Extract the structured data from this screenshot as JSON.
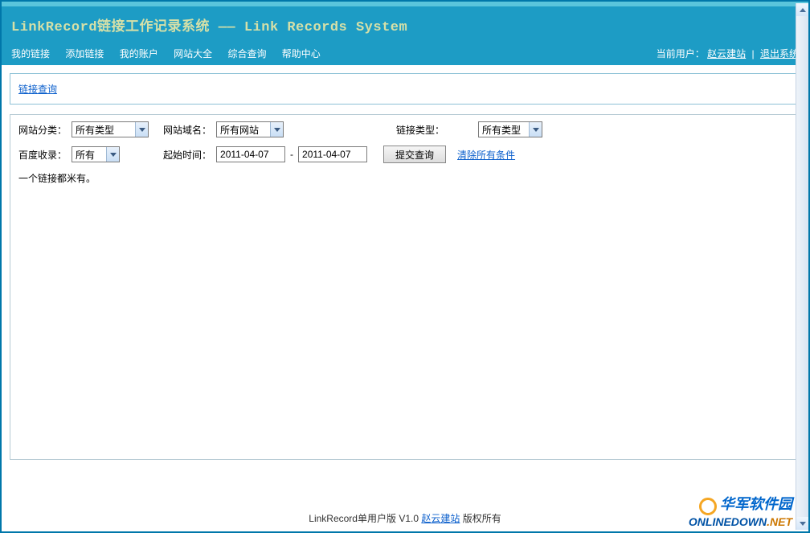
{
  "header": {
    "title_left": "LinkRecord链接工作记录系统",
    "title_sep": "——",
    "title_right": "Link Records System"
  },
  "nav": {
    "items": [
      "我的链接",
      "添加链接",
      "我的账户",
      "网站大全",
      "综合查询",
      "帮助中心"
    ],
    "current_user_label": "当前用户：",
    "current_user": "赵云建站",
    "logout": "退出系统"
  },
  "breadcrumb": {
    "label": "链接查询"
  },
  "form": {
    "row1": {
      "site_category_label": "网站分类：",
      "site_category_value": "所有类型",
      "site_domain_label": "网站域名：",
      "site_domain_value": "所有网站",
      "link_type_label": "链接类型：",
      "link_type_value": "所有类型"
    },
    "row2": {
      "baidu_index_label": "百度收录：",
      "baidu_index_value": "所有",
      "start_time_label": "起始时间：",
      "date_from": "2011-04-07",
      "dash": "-",
      "date_to": "2011-04-07",
      "submit_label": "提交查询",
      "clear_label": "清除所有条件"
    },
    "empty_msg": "一个链接都米有。"
  },
  "footer": {
    "left": "LinkRecord单用户版 V1.0",
    "link": "赵云建站",
    "right": "版权所有"
  },
  "watermark": {
    "cn": "华军软件园",
    "en_prefix": "ONLINEDOWN",
    "en_suffix": ".NET"
  }
}
